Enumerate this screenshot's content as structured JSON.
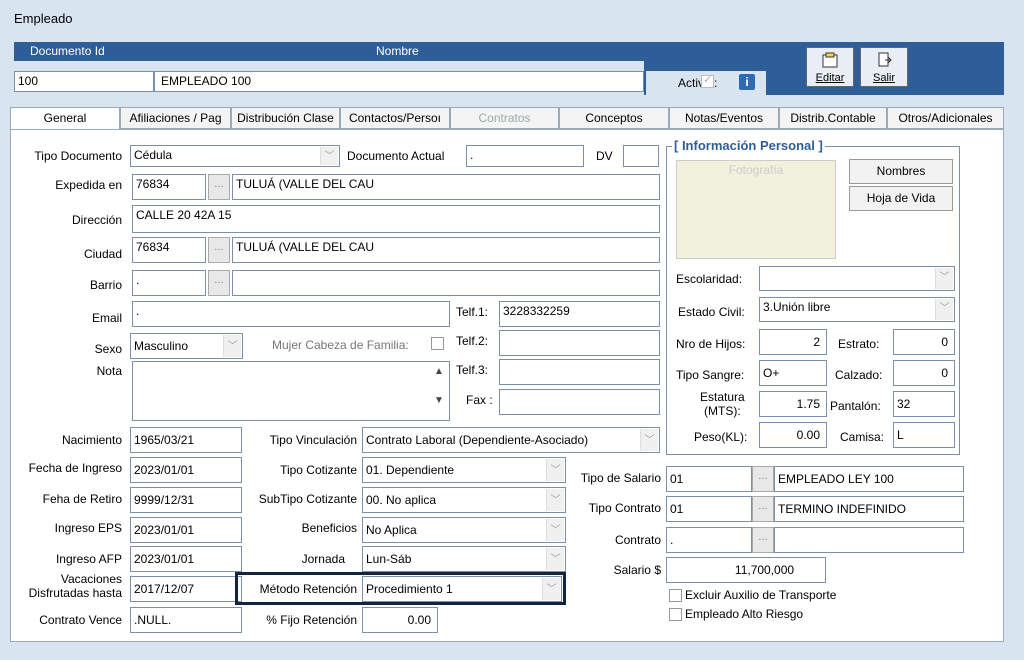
{
  "window": {
    "title": "Empleado"
  },
  "header": {
    "col_doc": "Documento Id",
    "col_name": "Nombre",
    "doc_value": "100",
    "name_value": "EMPLEADO 100",
    "activo_label": "Activo :",
    "info_icon": "i",
    "editar": "Editar",
    "salir": "Salir"
  },
  "tabs": [
    {
      "label": "General"
    },
    {
      "label": "Afiliaciones / Pag"
    },
    {
      "label": "Distribución Clase"
    },
    {
      "label": "Contactos/Persoı"
    },
    {
      "label": "Contratos"
    },
    {
      "label": "Conceptos"
    },
    {
      "label": "Notas/Eventos"
    },
    {
      "label": "Distrib.Contable"
    },
    {
      "label": "Otros/Adicionales"
    }
  ],
  "form": {
    "tipo_doc_label": "Tipo Documento",
    "tipo_doc": "Cédula",
    "doc_actual_label": "Documento Actual",
    "doc_actual": ".",
    "dv_label": "DV",
    "dv": "",
    "expedida_label": "Expedida en",
    "expedida_code": "76834",
    "expedida_name": "TULUÁ (VALLE DEL CAU",
    "direccion_label": "Dirección",
    "direccion": "CALLE 20  42A 15",
    "ciudad_label": "Ciudad",
    "ciudad_code": "76834",
    "ciudad_name": "TULUÁ (VALLE DEL CAU",
    "barrio_label": "Barrio",
    "barrio_code": ".",
    "barrio_name": "",
    "email_label": "Email",
    "email": ".",
    "telf1_label": "Telf.1:",
    "telf1": "3228332259",
    "sexo_label": "Sexo",
    "sexo": "Masculino",
    "mujer_label": "Mujer Cabeza de Familia:",
    "telf2_label": "Telf.2:",
    "telf2": "",
    "nota_label": "Nota",
    "nota": "",
    "telf3_label": "Telf.3:",
    "telf3": "",
    "fax_label": "Fax :",
    "fax": "",
    "nacimiento_label": "Nacimiento",
    "nacimiento": "1965/03/21",
    "tipo_vinc_label": "Tipo Vinculación",
    "tipo_vinc": "Contrato Laboral (Dependiente-Asociado)",
    "fecha_ingreso_label": "Fecha de Ingreso",
    "fecha_ingreso": "2023/01/01",
    "tipo_cot_label": "Tipo Cotizante",
    "tipo_cot": "01. Dependiente",
    "feha_retiro_label": "Feha de Retiro",
    "feha_retiro": "9999/12/31",
    "subtipo_label": "SubTipo Cotizante",
    "subtipo": "00. No aplica",
    "ingreso_eps_label": "Ingreso EPS",
    "ingreso_eps": "2023/01/01",
    "beneficios_label": "Beneficios",
    "beneficios": "No Aplica",
    "ingreso_afp_label": "Ingreso AFP",
    "ingreso_afp": "2023/01/01",
    "jornada_label": "Jornada",
    "jornada": "Lun-Sáb",
    "vac_label1": "Vacaciones",
    "vac_label2": "Disfrutadas hasta",
    "vacaciones": "2017/12/07",
    "metodo_label": "Método Retención",
    "metodo": "Procedimiento 1",
    "contrato_vence_label": "Contrato Vence",
    "contrato_vence": ".NULL.",
    "pct_label": "% Fijo Retención",
    "pct": "0.00",
    "tipo_salario_label": "Tipo de Salario",
    "tipo_salario_code": "01",
    "tipo_salario_name": "EMPLEADO LEY 100",
    "tipo_contrato_label": "Tipo Contrato",
    "tipo_contrato_code": "01",
    "tipo_contrato_name": "TERMINO INDEFINIDO",
    "contrato_label": "Contrato",
    "contrato_code": ".",
    "contrato_name": "",
    "salario_label": "Salario $",
    "salario": "11,700,000",
    "excluir_label": "Excluir Auxilio de Transporte",
    "alto_riesgo_label": "Empleado Alto Riesgo"
  },
  "personal": {
    "title": "[ Información Personal ]",
    "foto": "Fotografía",
    "nombres_btn": "Nombres",
    "hoja_btn": "Hoja de Vida",
    "escolaridad_label": "Escolaridad:",
    "escolaridad": "",
    "estado_civil_label": "Estado Civil:",
    "estado_civil": "3.Unión libre",
    "hijos_label": "Nro de Hijos:",
    "hijos": "2",
    "estrato_label": "Estrato:",
    "estrato": "0",
    "sangre_label": "Tipo Sangre:",
    "sangre": "O+",
    "calzado_label": "Calzado:",
    "calzado": "0",
    "estatura_label1": "Estatura",
    "estatura_label2": "(MTS):",
    "estatura": "1.75",
    "pantalon_label": "Pantalón:",
    "pantalon": "32",
    "peso_label": "Peso(KL):",
    "peso": "0.00",
    "camisa_label": "Camisa:",
    "camisa": "L"
  }
}
